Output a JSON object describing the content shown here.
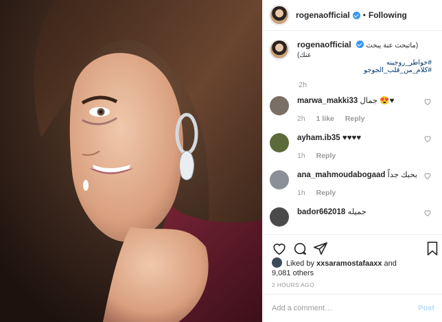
{
  "header": {
    "username": "rogenaofficial",
    "separator": "•",
    "follow_label": "Following"
  },
  "caption": {
    "username": "rogenaofficial",
    "text": "(ماتبحث عنة يبحث عنك)",
    "hashtags": [
      "#خواطر_روجينه",
      "#كلام_من_قلب_الجوجو"
    ],
    "time": "2h"
  },
  "comments": [
    {
      "username": "marwa_makki33",
      "text": "جمال 😍♥",
      "time": "2h",
      "likes": "1 like",
      "reply": "Reply",
      "avatar_color": "#7a6f66"
    },
    {
      "username": "ayham.ib35",
      "text": "♥♥♥♥",
      "time": "1h",
      "likes": "",
      "reply": "Reply",
      "avatar_color": "#5b6b3a"
    },
    {
      "username": "ana_mahmoudabogaad",
      "text": "بحبك جداً",
      "time": "1h",
      "likes": "",
      "reply": "Reply",
      "avatar_color": "#8a8f98"
    },
    {
      "username": "bador662018",
      "text": "جميله",
      "time": "",
      "likes": "",
      "reply": "",
      "avatar_color": "#4a4a4a"
    }
  ],
  "likes": {
    "prefix": "Liked by",
    "user": "xxsaramostafaaxx",
    "and": "and",
    "count": "9,081 others"
  },
  "posted": "2 HOURS AGO",
  "add_comment": {
    "placeholder": "Add a comment…",
    "post_label": "Post"
  },
  "colors": {
    "link": "#003569",
    "verified": "#3897f0",
    "post_disabled": "#b2dffc",
    "muted": "#999999"
  },
  "icons": [
    "heart-icon",
    "comment-icon",
    "share-icon",
    "bookmark-icon",
    "verified-badge-icon"
  ]
}
